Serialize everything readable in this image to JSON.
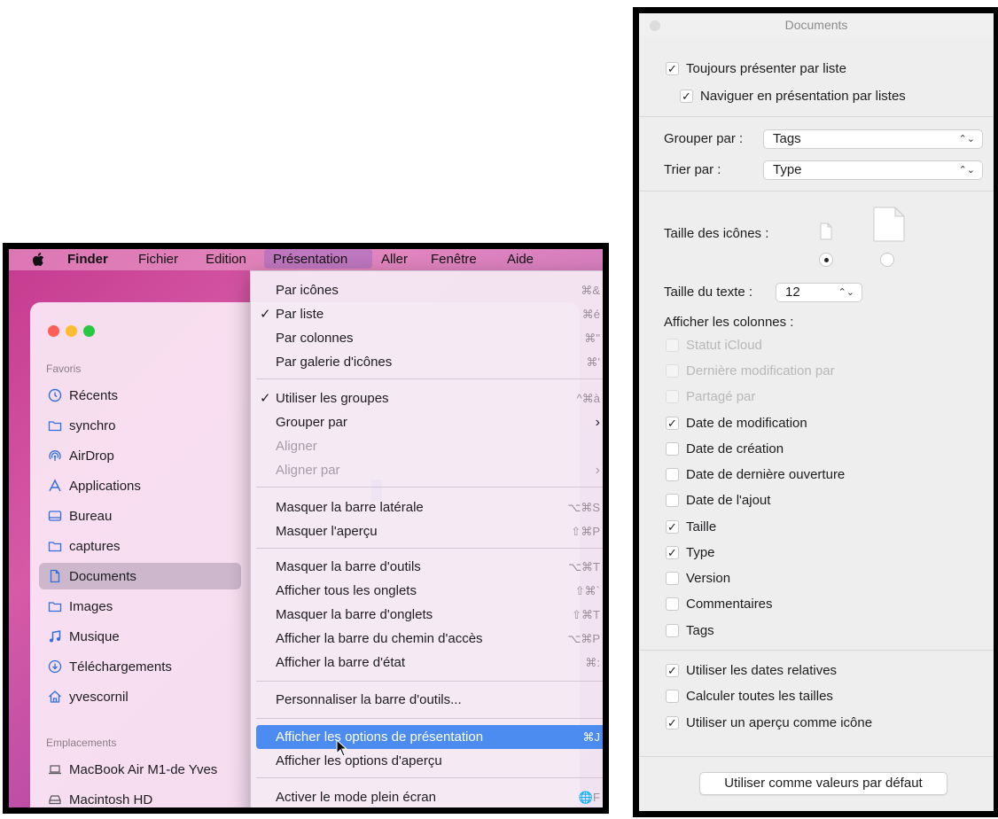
{
  "finder": {
    "menubar": {
      "app": "Finder",
      "items": [
        "Fichier",
        "Edition",
        "Présentation",
        "Aller",
        "Fenêtre",
        "Aide"
      ]
    },
    "sidebar": {
      "favorites_title": "Favoris",
      "favorites": [
        {
          "label": "Récents",
          "icon": "clock-icon"
        },
        {
          "label": "synchro",
          "icon": "folder-icon"
        },
        {
          "label": "AirDrop",
          "icon": "airdrop-icon"
        },
        {
          "label": "Applications",
          "icon": "applications-icon"
        },
        {
          "label": "Bureau",
          "icon": "desktop-icon"
        },
        {
          "label": "captures",
          "icon": "folder-icon"
        },
        {
          "label": "Documents",
          "icon": "document-icon"
        },
        {
          "label": "Images",
          "icon": "folder-icon"
        },
        {
          "label": "Musique",
          "icon": "music-icon"
        },
        {
          "label": "Téléchargements",
          "icon": "download-icon"
        },
        {
          "label": "yvescornil",
          "icon": "home-icon"
        }
      ],
      "locations_title": "Emplacements",
      "locations": [
        {
          "label": "MacBook Air M1-de Yves",
          "icon": "laptop-icon"
        },
        {
          "label": "Macintosh HD",
          "icon": "disk-icon"
        }
      ]
    },
    "menu": {
      "items": [
        {
          "label": "Par icônes",
          "shortcut": "⌘&",
          "checked": false
        },
        {
          "label": "Par liste",
          "shortcut": "⌘é",
          "checked": true
        },
        {
          "label": "Par colonnes",
          "shortcut": "⌘\"",
          "checked": false
        },
        {
          "label": "Par galerie d'icônes",
          "shortcut": "⌘'",
          "checked": false
        },
        {
          "label": "Utiliser les groupes",
          "shortcut": "^⌘à",
          "checked": true
        },
        {
          "label": "Grouper par",
          "submenu": true
        },
        {
          "label": "Aligner",
          "disabled": true
        },
        {
          "label": "Aligner par",
          "submenu": true,
          "disabled": true
        },
        {
          "label": "Masquer la barre latérale",
          "shortcut": "⌥⌘S"
        },
        {
          "label": "Masquer l'aperçu",
          "shortcut": "⇧⌘P"
        },
        {
          "label": "Masquer la barre d'outils",
          "shortcut": "⌥⌘T"
        },
        {
          "label": "Afficher tous les onglets",
          "shortcut": "⇧⌘`"
        },
        {
          "label": "Masquer la barre d'onglets",
          "shortcut": "⇧⌘T"
        },
        {
          "label": "Afficher la barre du chemin d'accès",
          "shortcut": "⌥⌘P"
        },
        {
          "label": "Afficher la barre d'état",
          "shortcut": "⌘:"
        },
        {
          "label": "Personnaliser la barre d'outils..."
        },
        {
          "label": "Afficher les options de présentation",
          "shortcut": "⌘J",
          "highlighted": true
        },
        {
          "label": "Afficher les options d'aperçu"
        },
        {
          "label": "Activer le mode plein écran",
          "shortcut": "🌐F"
        }
      ]
    }
  },
  "view_options": {
    "title": "Documents",
    "always_list": {
      "label": "Toujours présenter par liste",
      "checked": true
    },
    "browse_list": {
      "label": "Naviguer en présentation par listes",
      "checked": true
    },
    "group_by": {
      "label": "Grouper par :",
      "value": "Tags"
    },
    "sort_by": {
      "label": "Trier par :",
      "value": "Type"
    },
    "icon_size_label": "Taille des icônes :",
    "icon_size_selected": "small",
    "text_size": {
      "label": "Taille du texte :",
      "value": "12"
    },
    "columns_label": "Afficher les colonnes :",
    "columns": [
      {
        "label": "Statut iCloud",
        "checked": false,
        "disabled": true
      },
      {
        "label": "Dernière modification par",
        "checked": false,
        "disabled": true
      },
      {
        "label": "Partagé par",
        "checked": false,
        "disabled": true
      },
      {
        "label": "Date de modification",
        "checked": true
      },
      {
        "label": "Date de création",
        "checked": false
      },
      {
        "label": "Date de dernière ouverture",
        "checked": false
      },
      {
        "label": "Date de l'ajout",
        "checked": false
      },
      {
        "label": "Taille",
        "checked": true
      },
      {
        "label": "Type",
        "checked": true
      },
      {
        "label": "Version",
        "checked": false
      },
      {
        "label": "Commentaires",
        "checked": false
      },
      {
        "label": "Tags",
        "checked": false
      }
    ],
    "relative_dates": {
      "label": "Utiliser les dates relatives",
      "checked": true
    },
    "calc_sizes": {
      "label": "Calculer toutes les tailles",
      "checked": false
    },
    "preview_icon": {
      "label": "Utiliser un aperçu comme icône",
      "checked": true
    },
    "default_button": "Utiliser comme valeurs par défaut"
  }
}
